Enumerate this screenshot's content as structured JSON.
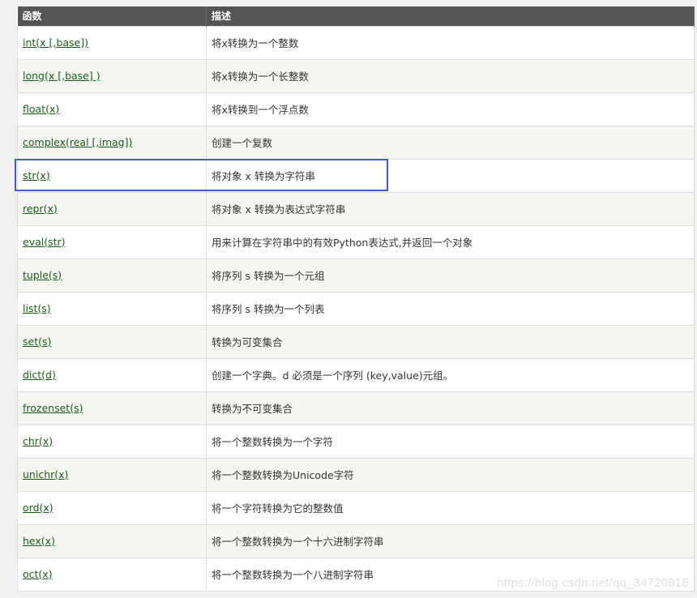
{
  "table": {
    "headers": [
      "函数",
      "描述"
    ],
    "rows": [
      {
        "func": "int(x [,base])",
        "desc": "将x转换为一个整数"
      },
      {
        "func": "long(x [,base] )",
        "desc": "将x转换为一个长整数"
      },
      {
        "func": "float(x)",
        "desc": "将x转换到一个浮点数"
      },
      {
        "func": "complex(real [,imag])",
        "desc": "创建一个复数"
      },
      {
        "func": "str(x)",
        "desc": "将对象 x 转换为字符串"
      },
      {
        "func": "repr(x)",
        "desc": "将对象 x 转换为表达式字符串"
      },
      {
        "func": "eval(str)",
        "desc": "用来计算在字符串中的有效Python表达式,并返回一个对象"
      },
      {
        "func": "tuple(s)",
        "desc": "将序列 s 转换为一个元组"
      },
      {
        "func": "list(s)",
        "desc": "将序列 s 转换为一个列表"
      },
      {
        "func": "set(s)",
        "desc": "转换为可变集合"
      },
      {
        "func": "dict(d)",
        "desc": "创建一个字典。d 必须是一个序列 (key,value)元组。"
      },
      {
        "func": "frozenset(s)",
        "desc": "转换为不可变集合"
      },
      {
        "func": "chr(x)",
        "desc": "将一个整数转换为一个字符"
      },
      {
        "func": "unichr(x)",
        "desc": "将一个整数转换为Unicode字符"
      },
      {
        "func": "ord(x)",
        "desc": "将一个字符转换为它的整数值"
      },
      {
        "func": "hex(x)",
        "desc": "将一个整数转换为一个十六进制字符串"
      },
      {
        "func": "oct(x)",
        "desc": "将一个整数转换为一个八进制字符串"
      }
    ]
  },
  "highlight": {
    "row_label": "str(x)",
    "color": "#3d5fc4"
  },
  "watermark": "https://blog.csdn.net/qq_34720818",
  "colors": {
    "header_bg": "#555555",
    "link": "#1a5c1a",
    "row_alt": "#f5f5f1"
  }
}
